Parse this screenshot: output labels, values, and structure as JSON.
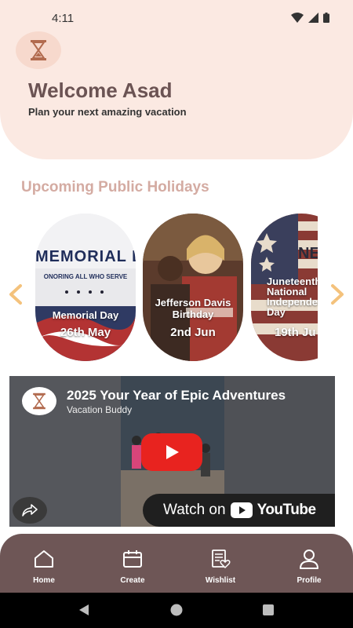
{
  "status_bar": {
    "time": "4:11"
  },
  "header": {
    "greeting": "Welcome Asad",
    "subtitle": "Plan your next amazing vacation"
  },
  "holidays": {
    "section_title": "Upcoming Public Holidays",
    "items": [
      {
        "banner": "MEMORIAL DA",
        "banner_sub": "ONORING ALL WHO SERVE",
        "name": "Memorial Day",
        "date": "26th May"
      },
      {
        "name": "Jefferson Davis Birthday",
        "date": "2nd Jun"
      },
      {
        "banner": "NETE",
        "name": "Juneteenth National Independence Day",
        "date": "19th Ju"
      }
    ]
  },
  "video": {
    "title": "2025 Your Year of Epic Adventures",
    "channel": "Vacation Buddy",
    "watch_on": "Watch on",
    "platform": "YouTube"
  },
  "nav": {
    "items": [
      {
        "label": "Home",
        "icon": "home-icon"
      },
      {
        "label": "Create",
        "icon": "calendar-icon"
      },
      {
        "label": "Wishlist",
        "icon": "wishlist-icon"
      },
      {
        "label": "Profile",
        "icon": "person-icon"
      }
    ]
  },
  "colors": {
    "header_bg": "#fbe9e2",
    "accent": "#6e5656",
    "section_title": "#d4aba2",
    "arrow": "#f4c27c"
  }
}
